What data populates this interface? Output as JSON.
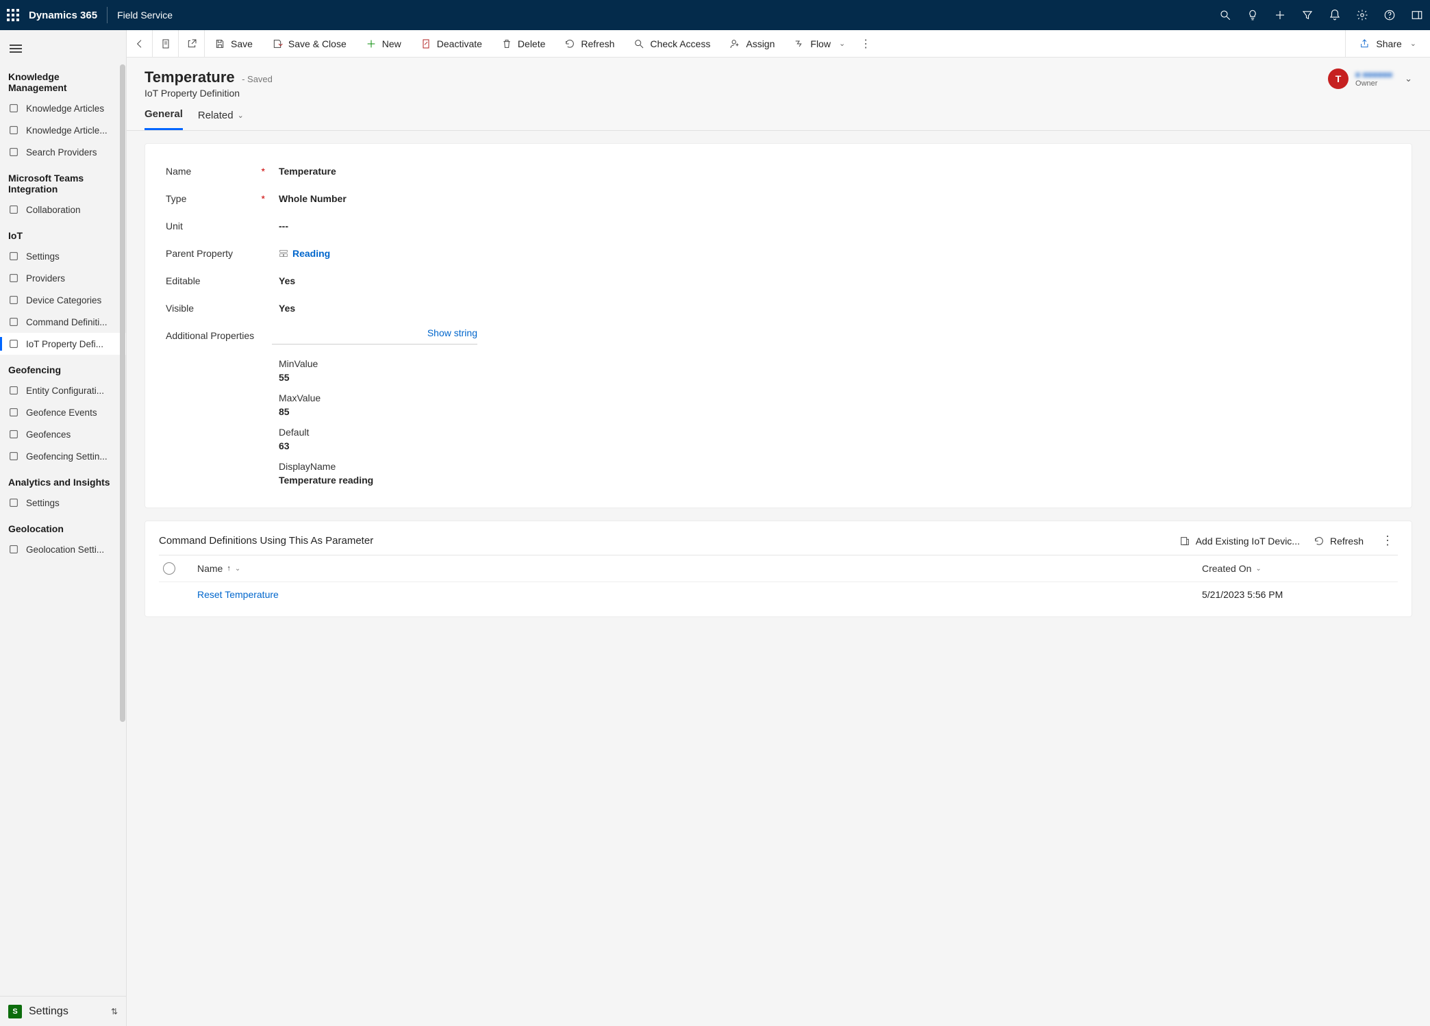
{
  "topbar": {
    "brand": "Dynamics 365",
    "app": "Field Service"
  },
  "sidebar": {
    "sections": [
      {
        "title": "Knowledge Management",
        "items": [
          {
            "label": "Knowledge Articles"
          },
          {
            "label": "Knowledge Article..."
          },
          {
            "label": "Search Providers"
          }
        ]
      },
      {
        "title": "Microsoft Teams Integration",
        "items": [
          {
            "label": "Collaboration"
          }
        ]
      },
      {
        "title": "IoT",
        "items": [
          {
            "label": "Settings"
          },
          {
            "label": "Providers"
          },
          {
            "label": "Device Categories"
          },
          {
            "label": "Command Definiti..."
          },
          {
            "label": "IoT Property Defi...",
            "active": true
          }
        ]
      },
      {
        "title": "Geofencing",
        "items": [
          {
            "label": "Entity Configurati..."
          },
          {
            "label": "Geofence Events"
          },
          {
            "label": "Geofences"
          },
          {
            "label": "Geofencing Settin..."
          }
        ]
      },
      {
        "title": "Analytics and Insights",
        "items": [
          {
            "label": "Settings"
          }
        ]
      },
      {
        "title": "Geolocation",
        "items": [
          {
            "label": "Geolocation Setti..."
          }
        ]
      }
    ],
    "area_letter": "S",
    "area_label": "Settings"
  },
  "cmdbar": {
    "save": "Save",
    "save_close": "Save & Close",
    "new": "New",
    "deactivate": "Deactivate",
    "delete": "Delete",
    "refresh": "Refresh",
    "check_access": "Check Access",
    "assign": "Assign",
    "flow": "Flow",
    "share": "Share"
  },
  "record": {
    "title": "Temperature",
    "status": "- Saved",
    "subtitle": "IoT Property Definition",
    "owner_avatar": "T",
    "owner_name": "■ ■■■■■■",
    "owner_role": "Owner",
    "tabs": {
      "general": "General",
      "related": "Related"
    }
  },
  "form": {
    "name_label": "Name",
    "name_value": "Temperature",
    "type_label": "Type",
    "type_value": "Whole Number",
    "unit_label": "Unit",
    "unit_value": "---",
    "parent_label": "Parent Property",
    "parent_value": "Reading",
    "editable_label": "Editable",
    "editable_value": "Yes",
    "visible_label": "Visible",
    "visible_value": "Yes",
    "additional_label": "Additional Properties",
    "show_string": "Show string",
    "props": [
      {
        "key": "MinValue",
        "val": "55"
      },
      {
        "key": "MaxValue",
        "val": "85"
      },
      {
        "key": "Default",
        "val": "63"
      },
      {
        "key": "DisplayName",
        "val": "Temperature reading"
      }
    ]
  },
  "subgrid": {
    "title": "Command Definitions Using This As Parameter",
    "add_label": "Add Existing IoT Devic...",
    "refresh_label": "Refresh",
    "col_name": "Name",
    "col_created": "Created On",
    "rows": [
      {
        "name": "Reset Temperature",
        "created": "5/21/2023 5:56 PM"
      }
    ]
  }
}
